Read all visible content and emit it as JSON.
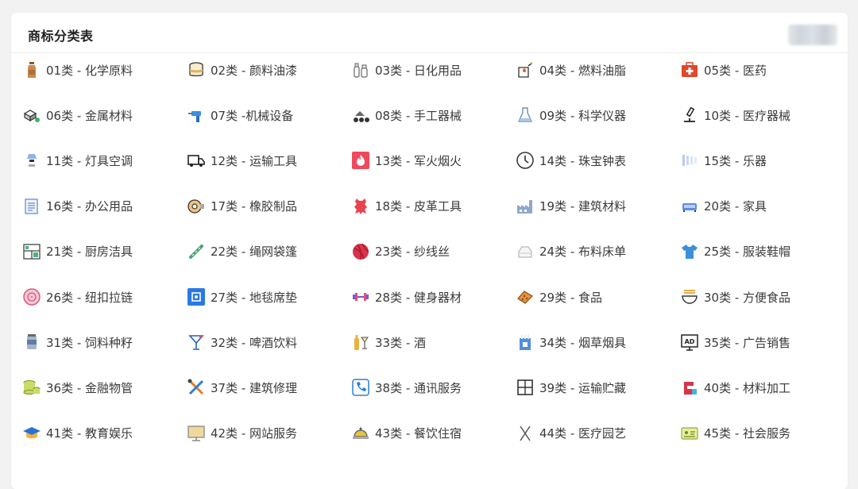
{
  "title": "商标分类表",
  "categories": [
    {
      "label": "01类 - 化学原料",
      "icon": "bottle-icon"
    },
    {
      "label": "02类 - 颜料油漆",
      "icon": "paint-bucket-icon"
    },
    {
      "label": "03类 - 日化用品",
      "icon": "cosmetics-icon"
    },
    {
      "label": "04类 - 燃料油脂",
      "icon": "oil-can-icon"
    },
    {
      "label": "05类 - 医药",
      "icon": "medical-kit-icon"
    },
    {
      "label": "06类 - 金属材料",
      "icon": "metal-blocks-icon"
    },
    {
      "label": "07类 -机械设备",
      "icon": "drill-icon"
    },
    {
      "label": "08类 - 手工器械",
      "icon": "hand-tool-icon"
    },
    {
      "label": "09类 - 科学仪器",
      "icon": "flask-icon"
    },
    {
      "label": "10类 - 医疗器械",
      "icon": "microscope-icon"
    },
    {
      "label": "11类 - 灯具空调",
      "icon": "lamp-icon"
    },
    {
      "label": "12类 - 运输工具",
      "icon": "truck-icon"
    },
    {
      "label": "13类 - 军火烟火",
      "icon": "fire-icon"
    },
    {
      "label": "14类 - 珠宝钟表",
      "icon": "clock-icon"
    },
    {
      "label": "15类 - 乐器",
      "icon": "xylophone-icon"
    },
    {
      "label": "16类 - 办公用品",
      "icon": "document-icon"
    },
    {
      "label": "17类 - 橡胶制品",
      "icon": "tape-roll-icon"
    },
    {
      "label": "18类 - 皮革工具",
      "icon": "leather-hide-icon"
    },
    {
      "label": "19类 - 建筑材料",
      "icon": "factory-icon"
    },
    {
      "label": "20类 - 家具",
      "icon": "sofa-icon"
    },
    {
      "label": "21类 - 厨房洁具",
      "icon": "kitchen-shelf-icon"
    },
    {
      "label": "22类 - 绳网袋篷",
      "icon": "rope-icon"
    },
    {
      "label": "23类 - 纱线丝",
      "icon": "yarn-ball-icon"
    },
    {
      "label": "24类 - 布料床单",
      "icon": "bed-sheet-icon"
    },
    {
      "label": "25类 - 服装鞋帽",
      "icon": "tshirt-icon"
    },
    {
      "label": "26类 - 纽扣拉链",
      "icon": "button-icon"
    },
    {
      "label": "27类 - 地毯席垫",
      "icon": "carpet-icon"
    },
    {
      "label": "28类 - 健身器材",
      "icon": "dumbbell-icon"
    },
    {
      "label": "29类 - 食品",
      "icon": "biscuit-icon"
    },
    {
      "label": "30类 - 方便食品",
      "icon": "noodle-bowl-icon"
    },
    {
      "label": "31类 - 饲料种籽",
      "icon": "feed-can-icon"
    },
    {
      "label": "32类 - 啤酒饮料",
      "icon": "cocktail-icon"
    },
    {
      "label": "33类 - 酒",
      "icon": "wine-icon"
    },
    {
      "label": "34类 - 烟草烟具",
      "icon": "cigarette-box-icon"
    },
    {
      "label": "35类 - 广告销售",
      "icon": "ad-board-icon"
    },
    {
      "label": "36类 - 金融物管",
      "icon": "coins-icon"
    },
    {
      "label": "37类 - 建筑修理",
      "icon": "repair-tools-icon"
    },
    {
      "label": "38类 - 通讯服务",
      "icon": "phone-icon"
    },
    {
      "label": "39类 - 运输贮藏",
      "icon": "storage-cabinet-icon"
    },
    {
      "label": "40类 - 材料加工",
      "icon": "mixer-icon"
    },
    {
      "label": "41类 - 教育娱乐",
      "icon": "graduation-cap-icon"
    },
    {
      "label": "42类 - 网站服务",
      "icon": "monitor-icon"
    },
    {
      "label": "43类 - 餐饮住宿",
      "icon": "dining-bell-icon"
    },
    {
      "label": "44类 - 医疗园艺",
      "icon": "scissors-icon"
    },
    {
      "label": "45类 - 社会服务",
      "icon": "id-card-icon"
    }
  ]
}
